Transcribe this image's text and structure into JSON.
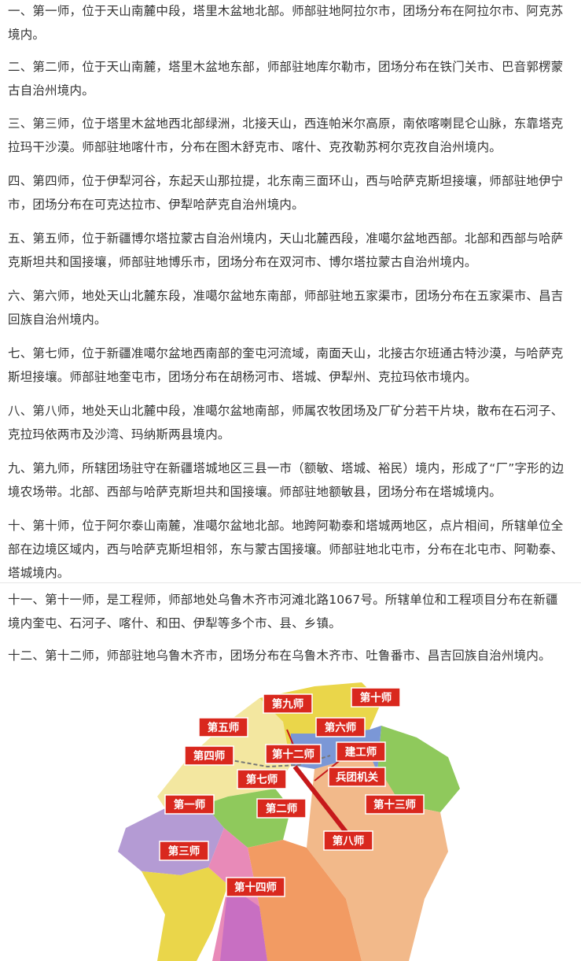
{
  "paragraphs": [
    "一、第一师，位于天山南麓中段，塔里木盆地北部。师部驻地阿拉尔市，团场分布在阿拉尔市、阿克苏境内。",
    "二、第二师，位于天山南麓，塔里木盆地东部，师部驻地库尔勒市，团场分布在铁门关市、巴音郭楞蒙古自治州境内。",
    "三、第三师，位于塔里木盆地西北部绿洲，北接天山，西连帕米尔高原，南依喀喇昆仑山脉，东靠塔克拉玛干沙漠。师部驻地喀什市，分布在图木舒克市、喀什、克孜勒苏柯尔克孜自治州境内。",
    "四、第四师，位于伊犁河谷，东起天山那拉提，北东南三面环山，西与哈萨克斯坦接壤，师部驻地伊宁市，团场分布在可克达拉市、伊犁哈萨克自治州境内。",
    "五、第五师，位于新疆博尔塔拉蒙古自治州境内，天山北麓西段，准噶尔盆地西部。北部和西部与哈萨克斯坦共和国接壤，师部驻地博乐市，团场分布在双河市、博尔塔拉蒙古自治州境内。",
    "六、第六师，地处天山北麓东段，准噶尔盆地东南部，师部驻地五家渠市，团场分布在五家渠市、昌吉回族自治州境内。",
    "七、第七师，位于新疆准噶尔盆地西南部的奎屯河流域，南面天山，北接古尔班通古特沙漠，与哈萨克斯坦接壤。师部驻地奎屯市，团场分布在胡杨河市、塔城、伊犁州、克拉玛依市境内。",
    "八、第八师，地处天山北麓中段，准噶尔盆地南部，师属农牧团场及厂矿分若干片块，散布在石河子、克拉玛依两市及沙湾、玛纳斯两县境内。",
    "九、第九师，所辖团场驻守在新疆塔城地区三县一市（额敏、塔城、裕民）境内，形成了“厂”字形的边境农场带。北部、西部与哈萨克斯坦共和国接壤。师部驻地额敏县，团场分布在塔城境内。",
    "十、第十师，位于阿尔泰山南麓，准噶尔盆地北部。地跨阿勒泰和塔城两地区，点片相间，所辖单位全部在边境区域内，西与哈萨克斯坦相邻，东与蒙古国接壤。师部驻地北屯市，分布在北屯市、阿勒泰、塔城境内。",
    "十一、第十一师，是工程师，师部地处乌鲁木齐市河滩北路1067号。所辖单位和工程项目分布在新疆境内奎屯、石河子、喀什、和田、伊犁等多个市、县、乡镇。",
    "十二、第十二师，师部驻地乌鲁木齐市，团场分布在乌鲁木齐市、吐鲁番市、昌吉回族自治州境内。"
  ],
  "map": {
    "labels": [
      "第九师",
      "第十师",
      "第五师",
      "第六师",
      "第四师",
      "第十二师",
      "建工师",
      "第七师",
      "兵团机关",
      "第一师",
      "第二师",
      "第十三师",
      "第八师",
      "第三师",
      "第十四师"
    ],
    "label_color": "#d9281e",
    "region_colors": [
      "#b49bd4",
      "#ead64a",
      "#f3e7a0",
      "#8fc95c",
      "#f2b98a",
      "#f29b63",
      "#e88ab8",
      "#c86fc2",
      "#7b97d6"
    ]
  }
}
